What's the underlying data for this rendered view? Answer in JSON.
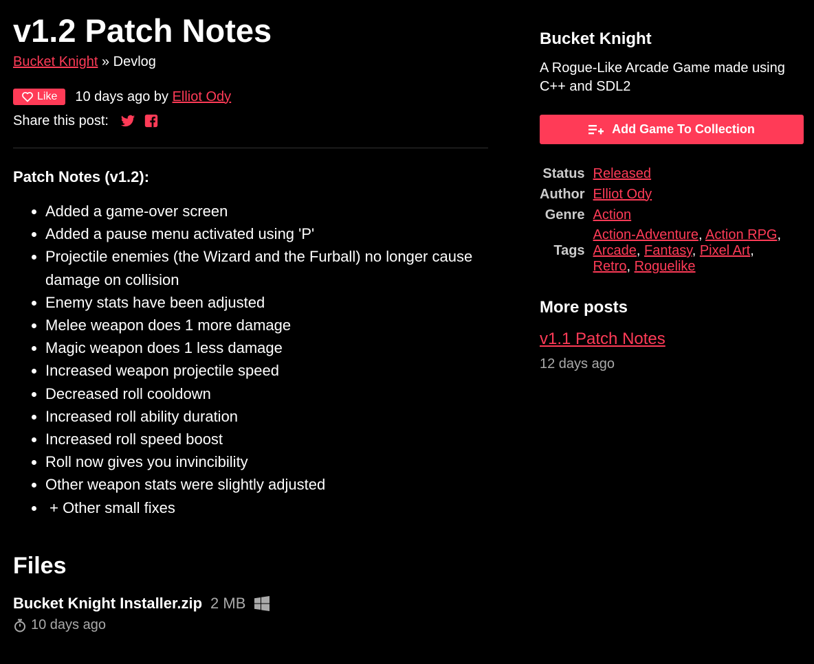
{
  "post": {
    "title": "v1.2 Patch Notes",
    "breadcrumb": {
      "game_link": "Bucket Knight",
      "separator": " » ",
      "section": "Devlog"
    },
    "like_label": "Like",
    "posted": "10 days ago by ",
    "author": "Elliot Ody",
    "share_label": "Share this post:",
    "share_icons": [
      "twitter-icon",
      "facebook-icon"
    ]
  },
  "notes": {
    "heading": "Patch Notes (v1.2):",
    "items": [
      "Added a game-over screen",
      "Added a pause menu activated using 'P'",
      "Projectile enemies (the Wizard and the Furball) no longer cause damage on collision",
      "Enemy stats have been adjusted",
      "Melee weapon does 1 more damage",
      "Magic weapon does 1 less damage",
      "Increased weapon projectile speed",
      "Decreased roll cooldown",
      "Increased roll ability duration",
      "Increased roll speed boost",
      "Roll now gives you invincibility",
      "Other weapon stats were slightly adjusted",
      " + Other small fixes"
    ]
  },
  "files": {
    "heading": "Files",
    "items": [
      {
        "name": "Bucket Knight Installer.zip",
        "size": "2 MB",
        "platform_icon": "windows-icon",
        "date": "10 days ago"
      }
    ]
  },
  "sidebar": {
    "game_title": "Bucket Knight",
    "description": "A Rogue-Like Arcade Game made using C++ and SDL2",
    "add_button": "Add Game To Collection",
    "info": {
      "status_label": "Status",
      "status_value": "Released",
      "author_label": "Author",
      "author_value": "Elliot Ody",
      "genre_label": "Genre",
      "genre_value": "Action",
      "tags_label": "Tags",
      "tags": [
        "Action-Adventure",
        "Action RPG",
        "Arcade",
        "Fantasy",
        "Pixel Art",
        "Retro",
        "Roguelike"
      ]
    },
    "more_posts_heading": "More posts",
    "more_posts": [
      {
        "title": "v1.1 Patch Notes",
        "date": "12 days ago"
      }
    ]
  },
  "colors": {
    "background": "#000000",
    "accent": "#ff3b57",
    "muted": "#aaaaaa",
    "text": "#ffffff"
  }
}
